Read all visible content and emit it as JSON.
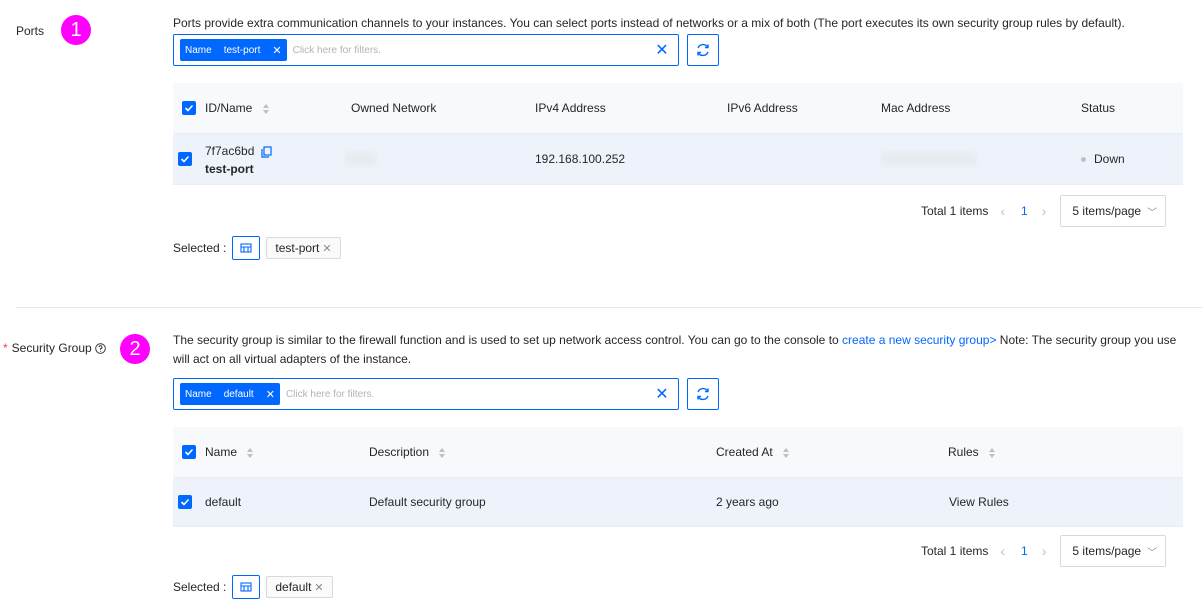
{
  "ports": {
    "label": "Ports",
    "badge": "1",
    "description": "Ports provide extra communication channels to your instances. You can select ports instead of networks or a mix of both (The port executes its own security group rules by default).",
    "filter": {
      "tag_key": "Name",
      "tag_value": "test-port",
      "placeholder": "Click here for filters."
    },
    "columns": [
      "ID/Name",
      "Owned Network",
      "IPv4 Address",
      "IPv6 Address",
      "Mac Address",
      "Status"
    ],
    "row": {
      "id": "7f7ac6bd",
      "name": "test-port",
      "ipv4": "192.168.100.252",
      "ipv6": "",
      "status": "Down"
    },
    "pagination": {
      "total": "Total 1 items",
      "page": "1",
      "page_size": "5 items/page"
    },
    "selected_label": "Selected :",
    "selected_item": "test-port"
  },
  "security_group": {
    "label": "Security Group",
    "badge": "2",
    "description_prefix": "The security group is similar to the firewall function and is used to set up network access control. You can go to the console to ",
    "description_link": "create a new security group>",
    "description_suffix": " Note: The security group you use will act on all virtual adapters of the instance.",
    "filter": {
      "tag_key": "Name",
      "tag_value": "default",
      "placeholder": "Click here for filters."
    },
    "columns": [
      "Name",
      "Description",
      "Created At",
      "Rules"
    ],
    "row": {
      "name": "default",
      "description": "Default security group",
      "created_at": "2 years ago",
      "rules": "View Rules"
    },
    "pagination": {
      "total": "Total 1 items",
      "page": "1",
      "page_size": "5 items/page"
    },
    "selected_label": "Selected :",
    "selected_item": "default"
  },
  "colors": {
    "primary": "#0068ff",
    "badge": "#ff00ff",
    "required": "#e8453c"
  }
}
